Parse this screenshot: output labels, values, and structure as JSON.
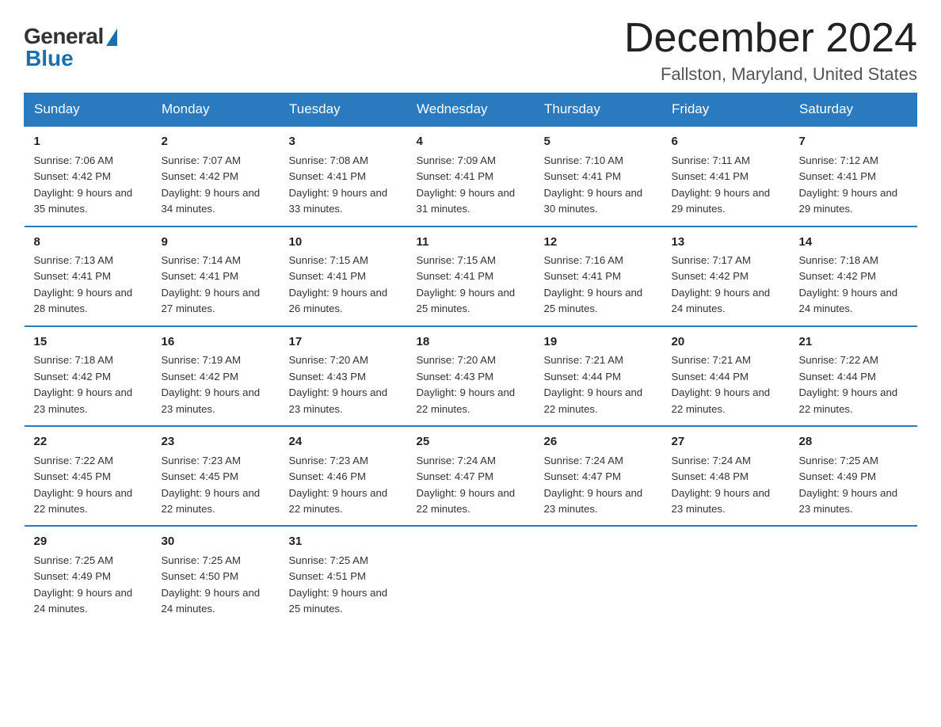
{
  "logo": {
    "general": "General",
    "blue": "Blue"
  },
  "title": "December 2024",
  "location": "Fallston, Maryland, United States",
  "weekdays": [
    "Sunday",
    "Monday",
    "Tuesday",
    "Wednesday",
    "Thursday",
    "Friday",
    "Saturday"
  ],
  "weeks": [
    [
      {
        "day": "1",
        "sunrise": "7:06 AM",
        "sunset": "4:42 PM",
        "daylight": "9 hours and 35 minutes."
      },
      {
        "day": "2",
        "sunrise": "7:07 AM",
        "sunset": "4:42 PM",
        "daylight": "9 hours and 34 minutes."
      },
      {
        "day": "3",
        "sunrise": "7:08 AM",
        "sunset": "4:41 PM",
        "daylight": "9 hours and 33 minutes."
      },
      {
        "day": "4",
        "sunrise": "7:09 AM",
        "sunset": "4:41 PM",
        "daylight": "9 hours and 31 minutes."
      },
      {
        "day": "5",
        "sunrise": "7:10 AM",
        "sunset": "4:41 PM",
        "daylight": "9 hours and 30 minutes."
      },
      {
        "day": "6",
        "sunrise": "7:11 AM",
        "sunset": "4:41 PM",
        "daylight": "9 hours and 29 minutes."
      },
      {
        "day": "7",
        "sunrise": "7:12 AM",
        "sunset": "4:41 PM",
        "daylight": "9 hours and 29 minutes."
      }
    ],
    [
      {
        "day": "8",
        "sunrise": "7:13 AM",
        "sunset": "4:41 PM",
        "daylight": "9 hours and 28 minutes."
      },
      {
        "day": "9",
        "sunrise": "7:14 AM",
        "sunset": "4:41 PM",
        "daylight": "9 hours and 27 minutes."
      },
      {
        "day": "10",
        "sunrise": "7:15 AM",
        "sunset": "4:41 PM",
        "daylight": "9 hours and 26 minutes."
      },
      {
        "day": "11",
        "sunrise": "7:15 AM",
        "sunset": "4:41 PM",
        "daylight": "9 hours and 25 minutes."
      },
      {
        "day": "12",
        "sunrise": "7:16 AM",
        "sunset": "4:41 PM",
        "daylight": "9 hours and 25 minutes."
      },
      {
        "day": "13",
        "sunrise": "7:17 AM",
        "sunset": "4:42 PM",
        "daylight": "9 hours and 24 minutes."
      },
      {
        "day": "14",
        "sunrise": "7:18 AM",
        "sunset": "4:42 PM",
        "daylight": "9 hours and 24 minutes."
      }
    ],
    [
      {
        "day": "15",
        "sunrise": "7:18 AM",
        "sunset": "4:42 PM",
        "daylight": "9 hours and 23 minutes."
      },
      {
        "day": "16",
        "sunrise": "7:19 AM",
        "sunset": "4:42 PM",
        "daylight": "9 hours and 23 minutes."
      },
      {
        "day": "17",
        "sunrise": "7:20 AM",
        "sunset": "4:43 PM",
        "daylight": "9 hours and 23 minutes."
      },
      {
        "day": "18",
        "sunrise": "7:20 AM",
        "sunset": "4:43 PM",
        "daylight": "9 hours and 22 minutes."
      },
      {
        "day": "19",
        "sunrise": "7:21 AM",
        "sunset": "4:44 PM",
        "daylight": "9 hours and 22 minutes."
      },
      {
        "day": "20",
        "sunrise": "7:21 AM",
        "sunset": "4:44 PM",
        "daylight": "9 hours and 22 minutes."
      },
      {
        "day": "21",
        "sunrise": "7:22 AM",
        "sunset": "4:44 PM",
        "daylight": "9 hours and 22 minutes."
      }
    ],
    [
      {
        "day": "22",
        "sunrise": "7:22 AM",
        "sunset": "4:45 PM",
        "daylight": "9 hours and 22 minutes."
      },
      {
        "day": "23",
        "sunrise": "7:23 AM",
        "sunset": "4:45 PM",
        "daylight": "9 hours and 22 minutes."
      },
      {
        "day": "24",
        "sunrise": "7:23 AM",
        "sunset": "4:46 PM",
        "daylight": "9 hours and 22 minutes."
      },
      {
        "day": "25",
        "sunrise": "7:24 AM",
        "sunset": "4:47 PM",
        "daylight": "9 hours and 22 minutes."
      },
      {
        "day": "26",
        "sunrise": "7:24 AM",
        "sunset": "4:47 PM",
        "daylight": "9 hours and 23 minutes."
      },
      {
        "day": "27",
        "sunrise": "7:24 AM",
        "sunset": "4:48 PM",
        "daylight": "9 hours and 23 minutes."
      },
      {
        "day": "28",
        "sunrise": "7:25 AM",
        "sunset": "4:49 PM",
        "daylight": "9 hours and 23 minutes."
      }
    ],
    [
      {
        "day": "29",
        "sunrise": "7:25 AM",
        "sunset": "4:49 PM",
        "daylight": "9 hours and 24 minutes."
      },
      {
        "day": "30",
        "sunrise": "7:25 AM",
        "sunset": "4:50 PM",
        "daylight": "9 hours and 24 minutes."
      },
      {
        "day": "31",
        "sunrise": "7:25 AM",
        "sunset": "4:51 PM",
        "daylight": "9 hours and 25 minutes."
      },
      null,
      null,
      null,
      null
    ]
  ]
}
